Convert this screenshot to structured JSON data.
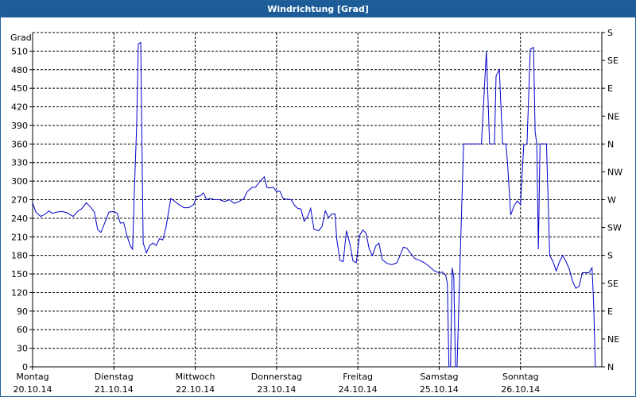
{
  "window": {
    "title": "Windrichtung [Grad]"
  },
  "colors": {
    "titlebar": "#1c5d99",
    "line": "#0000cc",
    "grid": "#000000"
  },
  "chart_data": {
    "type": "line",
    "title": "Windrichtung [Grad]",
    "ylabel": "Grad",
    "ylim": [
      0,
      540
    ],
    "y_ticks": [
      0,
      30,
      60,
      90,
      120,
      150,
      180,
      210,
      240,
      270,
      300,
      330,
      360,
      390,
      420,
      450,
      480,
      510
    ],
    "y2_ticks": [
      {
        "value": 0,
        "label": "N"
      },
      {
        "value": 45,
        "label": "NE"
      },
      {
        "value": 90,
        "label": "E"
      },
      {
        "value": 135,
        "label": "SE"
      },
      {
        "value": 180,
        "label": "S"
      },
      {
        "value": 225,
        "label": "SW"
      },
      {
        "value": 270,
        "label": "W"
      },
      {
        "value": 315,
        "label": "NW"
      },
      {
        "value": 360,
        "label": "N"
      },
      {
        "value": 405,
        "label": "NE"
      },
      {
        "value": 450,
        "label": "E"
      },
      {
        "value": 495,
        "label": "SE"
      },
      {
        "value": 540,
        "label": "S"
      }
    ],
    "xlim": [
      0,
      7
    ],
    "x_unit": "days since Montag 20.10.14 00:00",
    "x_ticks": [
      {
        "day": "Montag",
        "date": "20.10.14"
      },
      {
        "day": "Dienstag",
        "date": "21.10.14"
      },
      {
        "day": "Mittwoch",
        "date": "22.10.14"
      },
      {
        "day": "Donnerstag",
        "date": "23.10.14"
      },
      {
        "day": "Freitag",
        "date": "24.10.14"
      },
      {
        "day": "Samstag",
        "date": "25.10.14"
      },
      {
        "day": "Sonntag",
        "date": "26.10.14"
      }
    ],
    "grid": true,
    "series": [
      {
        "name": "",
        "color": "#0000cc",
        "points": [
          [
            0.0,
            265
          ],
          [
            0.04,
            250
          ],
          [
            0.1,
            243
          ],
          [
            0.16,
            247
          ],
          [
            0.2,
            252
          ],
          [
            0.24,
            248
          ],
          [
            0.3,
            250
          ],
          [
            0.36,
            251
          ],
          [
            0.42,
            249
          ],
          [
            0.5,
            243
          ],
          [
            0.56,
            252
          ],
          [
            0.6,
            255
          ],
          [
            0.66,
            265
          ],
          [
            0.7,
            260
          ],
          [
            0.76,
            250
          ],
          [
            0.8,
            222
          ],
          [
            0.84,
            217
          ],
          [
            0.88,
            230
          ],
          [
            0.94,
            250
          ],
          [
            1.0,
            251
          ],
          [
            1.04,
            248
          ],
          [
            1.08,
            232
          ],
          [
            1.12,
            233
          ],
          [
            1.16,
            212
          ],
          [
            1.2,
            196
          ],
          [
            1.23,
            190
          ],
          [
            1.25,
            280
          ],
          [
            1.28,
            390
          ],
          [
            1.3,
            522
          ],
          [
            1.33,
            524
          ],
          [
            1.36,
            200
          ],
          [
            1.4,
            184
          ],
          [
            1.44,
            196
          ],
          [
            1.48,
            200
          ],
          [
            1.52,
            196
          ],
          [
            1.56,
            207
          ],
          [
            1.6,
            205
          ],
          [
            1.64,
            225
          ],
          [
            1.7,
            272
          ],
          [
            1.76,
            266
          ],
          [
            1.8,
            262
          ],
          [
            1.86,
            257
          ],
          [
            1.92,
            257
          ],
          [
            1.98,
            262
          ],
          [
            2.02,
            275
          ],
          [
            2.06,
            276
          ],
          [
            2.1,
            281
          ],
          [
            2.14,
            270
          ],
          [
            2.18,
            272
          ],
          [
            2.24,
            270
          ],
          [
            2.3,
            270
          ],
          [
            2.36,
            267
          ],
          [
            2.42,
            270
          ],
          [
            2.48,
            264
          ],
          [
            2.54,
            267
          ],
          [
            2.6,
            272
          ],
          [
            2.64,
            283
          ],
          [
            2.7,
            290
          ],
          [
            2.74,
            290
          ],
          [
            2.78,
            297
          ],
          [
            2.82,
            303
          ],
          [
            2.85,
            307
          ],
          [
            2.88,
            290
          ],
          [
            2.92,
            289
          ],
          [
            2.96,
            290
          ],
          [
            3.0,
            283
          ],
          [
            3.04,
            284
          ],
          [
            3.08,
            272
          ],
          [
            3.12,
            271
          ],
          [
            3.18,
            270
          ],
          [
            3.22,
            261
          ],
          [
            3.26,
            256
          ],
          [
            3.3,
            255
          ],
          [
            3.34,
            235
          ],
          [
            3.38,
            242
          ],
          [
            3.42,
            256
          ],
          [
            3.46,
            222
          ],
          [
            3.52,
            220
          ],
          [
            3.56,
            227
          ],
          [
            3.6,
            252
          ],
          [
            3.64,
            241
          ],
          [
            3.68,
            247
          ],
          [
            3.72,
            247
          ],
          [
            3.74,
            207
          ],
          [
            3.78,
            172
          ],
          [
            3.82,
            170
          ],
          [
            3.86,
            220
          ],
          [
            3.9,
            200
          ],
          [
            3.94,
            171
          ],
          [
            3.98,
            168
          ],
          [
            4.02,
            212
          ],
          [
            4.06,
            221
          ],
          [
            4.1,
            216
          ],
          [
            4.14,
            190
          ],
          [
            4.18,
            180
          ],
          [
            4.22,
            195
          ],
          [
            4.26,
            200
          ],
          [
            4.3,
            173
          ],
          [
            4.36,
            167
          ],
          [
            4.42,
            165
          ],
          [
            4.48,
            168
          ],
          [
            4.52,
            180
          ],
          [
            4.56,
            193
          ],
          [
            4.6,
            192
          ],
          [
            4.64,
            185
          ],
          [
            4.7,
            175
          ],
          [
            4.76,
            172
          ],
          [
            4.82,
            168
          ],
          [
            4.88,
            162
          ],
          [
            4.94,
            155
          ],
          [
            5.0,
            152
          ],
          [
            5.04,
            153
          ],
          [
            5.08,
            148
          ],
          [
            5.1,
            135
          ],
          [
            5.12,
            0
          ],
          [
            5.14,
            0
          ],
          [
            5.16,
            160
          ],
          [
            5.18,
            145
          ],
          [
            5.2,
            0
          ],
          [
            5.22,
            0
          ],
          [
            5.3,
            360
          ],
          [
            5.4,
            360
          ],
          [
            5.48,
            360
          ],
          [
            5.52,
            360
          ],
          [
            5.56,
            460
          ],
          [
            5.58,
            510
          ],
          [
            5.62,
            360
          ],
          [
            5.68,
            360
          ],
          [
            5.7,
            470
          ],
          [
            5.74,
            480
          ],
          [
            5.78,
            360
          ],
          [
            5.82,
            360
          ],
          [
            5.84,
            332
          ],
          [
            5.88,
            245
          ],
          [
            5.92,
            260
          ],
          [
            5.96,
            268
          ],
          [
            6.0,
            262
          ],
          [
            6.04,
            358
          ],
          [
            6.08,
            360
          ],
          [
            6.12,
            513
          ],
          [
            6.16,
            516
          ],
          [
            6.18,
            380
          ],
          [
            6.2,
            360
          ],
          [
            6.22,
            190
          ],
          [
            6.24,
            360
          ],
          [
            6.28,
            360
          ],
          [
            6.32,
            360
          ],
          [
            6.36,
            180
          ],
          [
            6.4,
            170
          ],
          [
            6.44,
            155
          ],
          [
            6.48,
            170
          ],
          [
            6.52,
            180
          ],
          [
            6.56,
            170
          ],
          [
            6.6,
            158
          ],
          [
            6.64,
            138
          ],
          [
            6.68,
            127
          ],
          [
            6.72,
            130
          ],
          [
            6.76,
            152
          ],
          [
            6.8,
            152
          ],
          [
            6.84,
            152
          ],
          [
            6.88,
            160
          ],
          [
            6.9,
            100
          ],
          [
            6.92,
            0
          ]
        ]
      }
    ]
  }
}
